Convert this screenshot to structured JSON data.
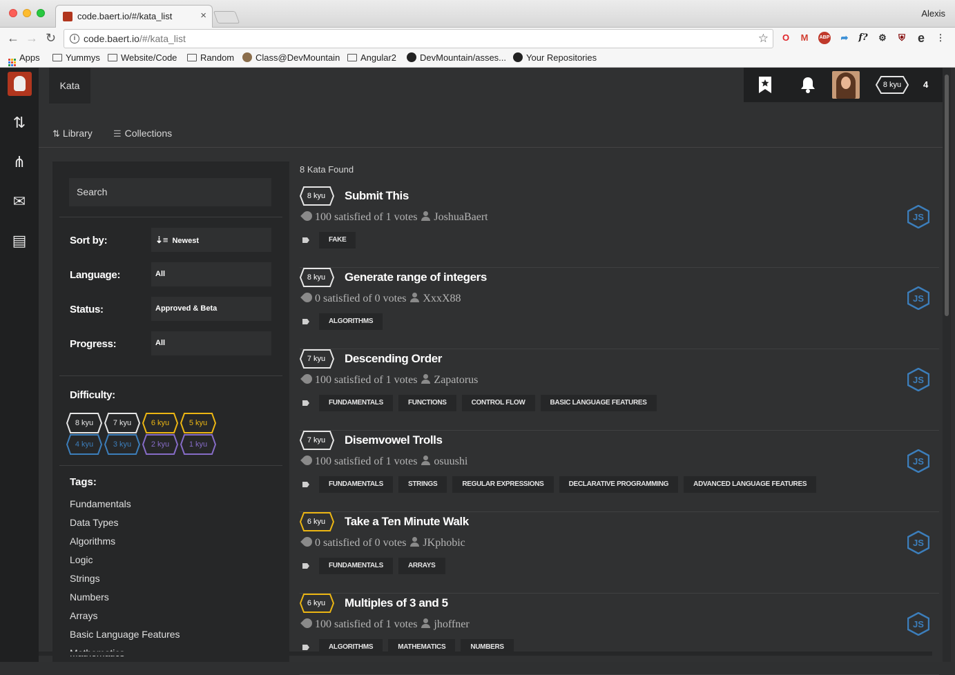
{
  "browser": {
    "tab_title": "code.baert.io/#/kata_list",
    "tab_close": "×",
    "profile_name": "Alexis",
    "url_host": "code.baert.io",
    "url_path": "/#/kata_list",
    "bookmarks": [
      "Apps",
      "Yummys",
      "Website/Code",
      "Random",
      "Class@DevMountain",
      "Angular2",
      "DevMountain/asses...",
      "Your Repositories"
    ],
    "extensions": [
      "opera-icon",
      "gmail-icon",
      "adblock-icon",
      "dropper-icon",
      "formula-icon",
      "gear-icon",
      "ublock-icon",
      "edge-icon",
      "more-icon"
    ]
  },
  "header": {
    "kata_label": "Kata",
    "rank": "8 kyu",
    "honor": "4"
  },
  "subnav": {
    "library": "Library",
    "collections": "Collections"
  },
  "filters": {
    "search_placeholder": "Search",
    "sort_label": "Sort by:",
    "sort_value": "Newest",
    "language_label": "Language:",
    "language_value": "All",
    "status_label": "Status:",
    "status_value": "Approved & Beta",
    "progress_label": "Progress:",
    "progress_value": "All",
    "difficulty_label": "Difficulty:",
    "difficulties": [
      {
        "label": "8 kyu",
        "color": "#e6e6e6"
      },
      {
        "label": "7 kyu",
        "color": "#e6e6e6"
      },
      {
        "label": "6 kyu",
        "color": "#ecb613"
      },
      {
        "label": "5 kyu",
        "color": "#ecb613"
      },
      {
        "label": "4 kyu",
        "color": "#3c7ebb"
      },
      {
        "label": "3 kyu",
        "color": "#3c7ebb"
      },
      {
        "label": "2 kyu",
        "color": "#866cc7"
      },
      {
        "label": "1 kyu",
        "color": "#866cc7"
      }
    ],
    "tags_label": "Tags:",
    "tags": [
      "Fundamentals",
      "Data Types",
      "Algorithms",
      "Logic",
      "Strings",
      "Numbers",
      "Arrays",
      "Basic Language Features",
      "Mathematics"
    ]
  },
  "results": {
    "found_text": "8 Kata Found",
    "katas": [
      {
        "rank": "8 kyu",
        "rank_color": "#e6e6e6",
        "title": "Submit This",
        "satisfaction": "100 satisfied of 1 votes",
        "author": "JoshuaBaert",
        "tags": [
          "FAKE"
        ]
      },
      {
        "rank": "8 kyu",
        "rank_color": "#e6e6e6",
        "title": "Generate range of integers",
        "satisfaction": "0 satisfied of 0 votes",
        "author": "XxxX88",
        "tags": [
          "ALGORITHMS"
        ]
      },
      {
        "rank": "7 kyu",
        "rank_color": "#e6e6e6",
        "title": "Descending Order",
        "satisfaction": "100 satisfied of 1 votes",
        "author": "Zapatorus",
        "tags": [
          "FUNDAMENTALS",
          "FUNCTIONS",
          "CONTROL FLOW",
          "BASIC LANGUAGE FEATURES"
        ]
      },
      {
        "rank": "7 kyu",
        "rank_color": "#e6e6e6",
        "title": "Disemvowel Trolls",
        "satisfaction": "100 satisfied of 1 votes",
        "author": "osuushi",
        "tags": [
          "FUNDAMENTALS",
          "STRINGS",
          "REGULAR EXPRESSIONS",
          "DECLARATIVE PROGRAMMING",
          "ADVANCED LANGUAGE FEATURES"
        ]
      },
      {
        "rank": "6 kyu",
        "rank_color": "#ecb613",
        "title": "Take a Ten Minute Walk",
        "satisfaction": "0 satisfied of 0 votes",
        "author": "JKphobic",
        "tags": [
          "FUNDAMENTALS",
          "ARRAYS"
        ]
      },
      {
        "rank": "6 kyu",
        "rank_color": "#ecb613",
        "title": "Multiples of 3 and 5",
        "satisfaction": "100 satisfied of 1 votes",
        "author": "jhoffner",
        "tags": [
          "ALGORITHMS",
          "MATHEMATICS",
          "NUMBERS"
        ]
      }
    ]
  },
  "colors": {
    "accent_js": "#3c7ebb"
  }
}
